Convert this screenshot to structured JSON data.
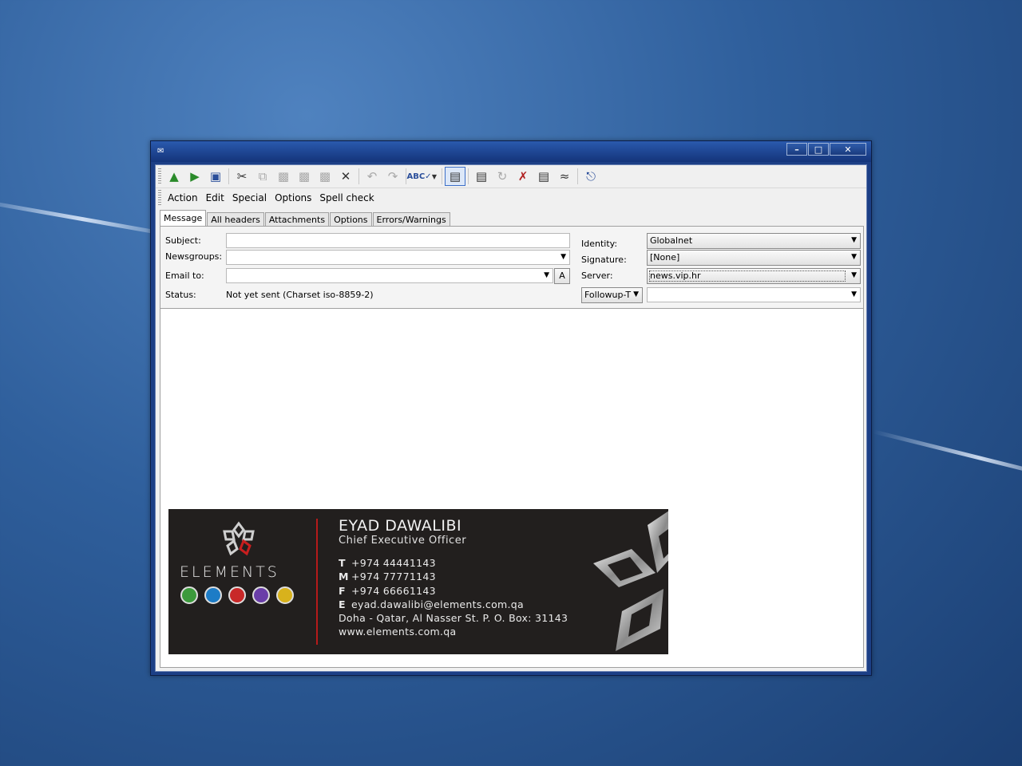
{
  "window": {
    "minimize_glyph": "–",
    "maximize_glyph": "□",
    "close_glyph": "✕"
  },
  "toolbar": {
    "icons": [
      "send-now-icon",
      "send-later-icon",
      "save-icon",
      "cut-icon",
      "copy-icon",
      "paste-icon",
      "paste-quote-icon",
      "paste-special-icon",
      "delete-icon",
      "undo-icon",
      "redo-icon",
      "spell-check-icon",
      "wrap-text-icon",
      "headers-icon",
      "rot13-icon",
      "remove-icon",
      "template-icon",
      "signature-icon",
      "attach-icon"
    ]
  },
  "menu": {
    "items": [
      "Action",
      "Edit",
      "Special",
      "Options",
      "Spell check"
    ]
  },
  "tabs": [
    "Message",
    "All headers",
    "Attachments",
    "Options",
    "Errors/Warnings"
  ],
  "headers": {
    "subject_label": "Subject:",
    "subject_value": "",
    "newsgroups_label": "Newsgroups:",
    "newsgroups_value": "",
    "email_to_label": "Email to:",
    "email_to_value": "",
    "address_button": "A",
    "status_label": "Status:",
    "status_value": "Not yet sent (Charset iso-8859-2)",
    "identity_label": "Identity:",
    "identity_value": "Globalnet",
    "signature_label": "Signature:",
    "signature_value": "[None]",
    "server_label": "Server:",
    "server_value": "news.vip.hr",
    "followup_label": "Followup-T",
    "followup_value": ""
  },
  "signature_card": {
    "logo_text": "ELEMENTS",
    "name": "EYAD DAWALIBI",
    "title": "Chief Executive Officer",
    "phone_label": "T",
    "phone": "+974 44441143",
    "mobile_label": "M",
    "mobile": "+974 77771143",
    "fax_label": "F",
    "fax": "+974 66661143",
    "email_label": "E",
    "email": "eyad.dawalibi@elements.com.qa",
    "address": "Doha - Qatar, Al Nasser St. P. O. Box: 31143",
    "website": "www.elements.com.qa"
  },
  "colors": {
    "titlebar": "#1c3f86",
    "card_background": "#221f1e",
    "card_accent": "#b61a1a"
  }
}
